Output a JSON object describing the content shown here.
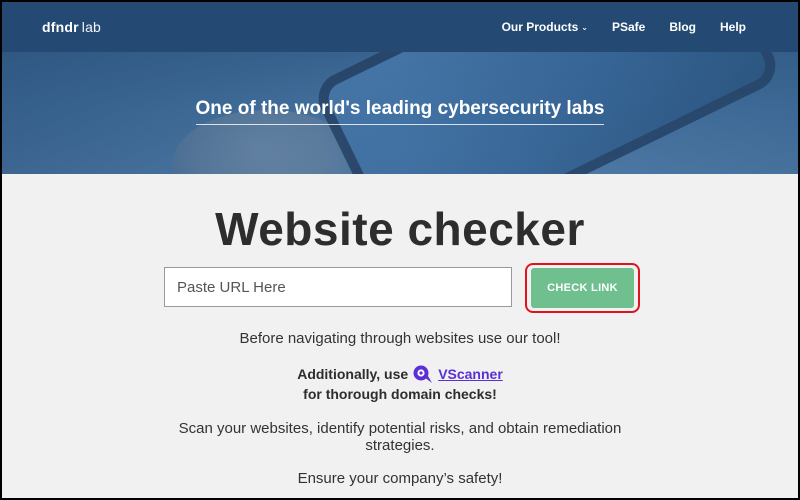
{
  "header": {
    "logo_brand": "dfndr",
    "logo_suffix": "lab",
    "nav": [
      {
        "label": "Our Products",
        "has_dropdown": true
      },
      {
        "label": "PSafe"
      },
      {
        "label": "Blog"
      },
      {
        "label": "Help"
      }
    ]
  },
  "hero": {
    "title": "One of the world's leading cybersecurity labs"
  },
  "main": {
    "title": "Website checker",
    "url_input": {
      "placeholder": "Paste URL Here",
      "value": ""
    },
    "check_button_label": "CHECK LINK",
    "intro": "Before navigating through websites use our tool!",
    "promo_prefix": "Additionally, use",
    "promo_link": "VScanner",
    "promo_suffix": "for thorough domain checks!",
    "scan_text": "Scan your websites, identify potential risks, and obtain remediation strategies.",
    "ensure_text": "Ensure your company’s safety!"
  },
  "colors": {
    "header_bg": "#244a74",
    "check_button": "#6fbf8f",
    "highlight": "#e0141e",
    "vscanner_link": "#5a2fd6"
  },
  "icons": {
    "dropdown": "chevron-down-icon",
    "vscanner": "vscanner-logo-icon"
  }
}
